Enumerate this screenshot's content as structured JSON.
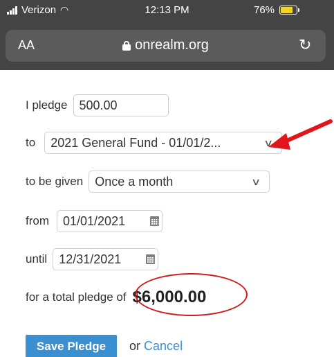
{
  "status_bar": {
    "carrier": "Verizon",
    "time": "12:13 PM",
    "battery": "76%"
  },
  "address_bar": {
    "text_size_label": "AA",
    "url": "onrealm.org",
    "reload_icon": "reload-icon"
  },
  "form": {
    "pledge_label": "I pledge",
    "pledge_amount": "500.00",
    "to_label": "to",
    "fund_selected": "2021 General Fund - 01/01/2...",
    "given_label": "to be given",
    "frequency_selected": "Once a month",
    "from_label": "from",
    "from_date": "01/01/2021",
    "until_label": "until",
    "until_date": "12/31/2021",
    "total_label": "for a total pledge of",
    "total_amount": "$6,000.00"
  },
  "actions": {
    "save_label": "Save Pledge",
    "or_text": "or",
    "cancel_label": "Cancel"
  },
  "annotations": {
    "arrow_color": "#e0161c",
    "ellipse_color": "#d0171b"
  }
}
